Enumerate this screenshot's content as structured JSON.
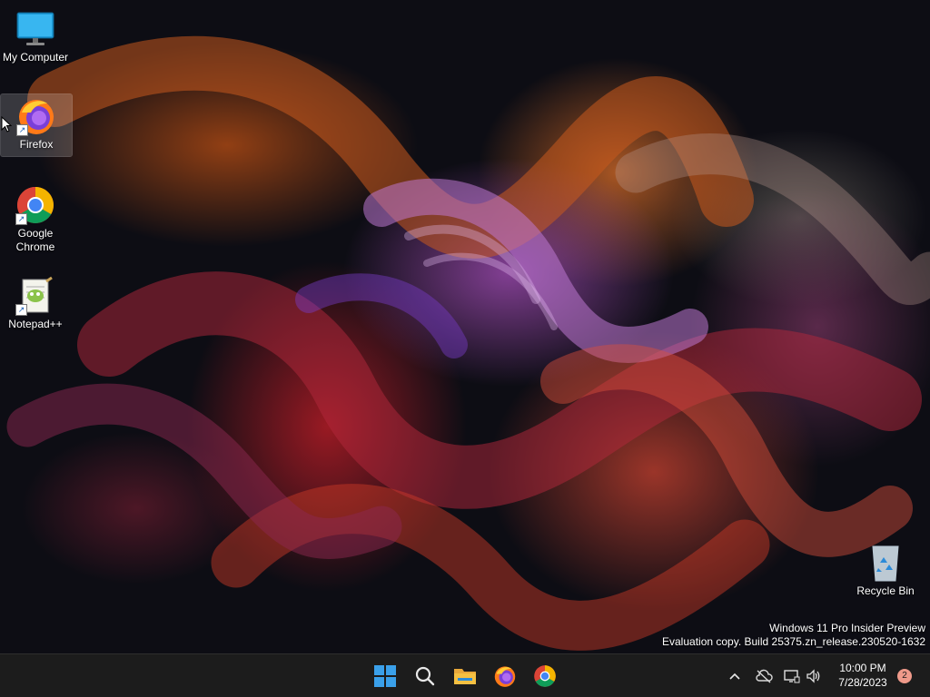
{
  "desktop": {
    "icons": [
      {
        "label": "My Computer",
        "icon": "monitor-icon"
      },
      {
        "label": "Firefox",
        "icon": "firefox-icon"
      },
      {
        "label": "Google Chrome",
        "icon": "chrome-icon"
      },
      {
        "label": "Notepad++",
        "icon": "notepadpp-icon"
      },
      {
        "label": "Recycle Bin",
        "icon": "recycle-bin-icon"
      }
    ]
  },
  "watermark": {
    "line1": "Windows 11 Pro Insider Preview",
    "line2": "Evaluation copy. Build 25375.zn_release.230520-1632"
  },
  "taskbar": {
    "pinned": [
      {
        "name": "start-button",
        "icon": "windows-logo-icon"
      },
      {
        "name": "search-button",
        "icon": "search-icon"
      },
      {
        "name": "file-explorer-button",
        "icon": "folder-icon"
      },
      {
        "name": "firefox-taskbar-button",
        "icon": "firefox-icon"
      },
      {
        "name": "chrome-taskbar-button",
        "icon": "chrome-icon"
      }
    ],
    "tray": {
      "time": "10:00 PM",
      "date": "7/28/2023",
      "notification_count": "2"
    }
  },
  "colors": {
    "taskbar_bg": "#1c1c1c",
    "windows_blue": "#2b8ad8",
    "folder_yellow": "#f4c042",
    "badge": "#ef9a8a"
  }
}
